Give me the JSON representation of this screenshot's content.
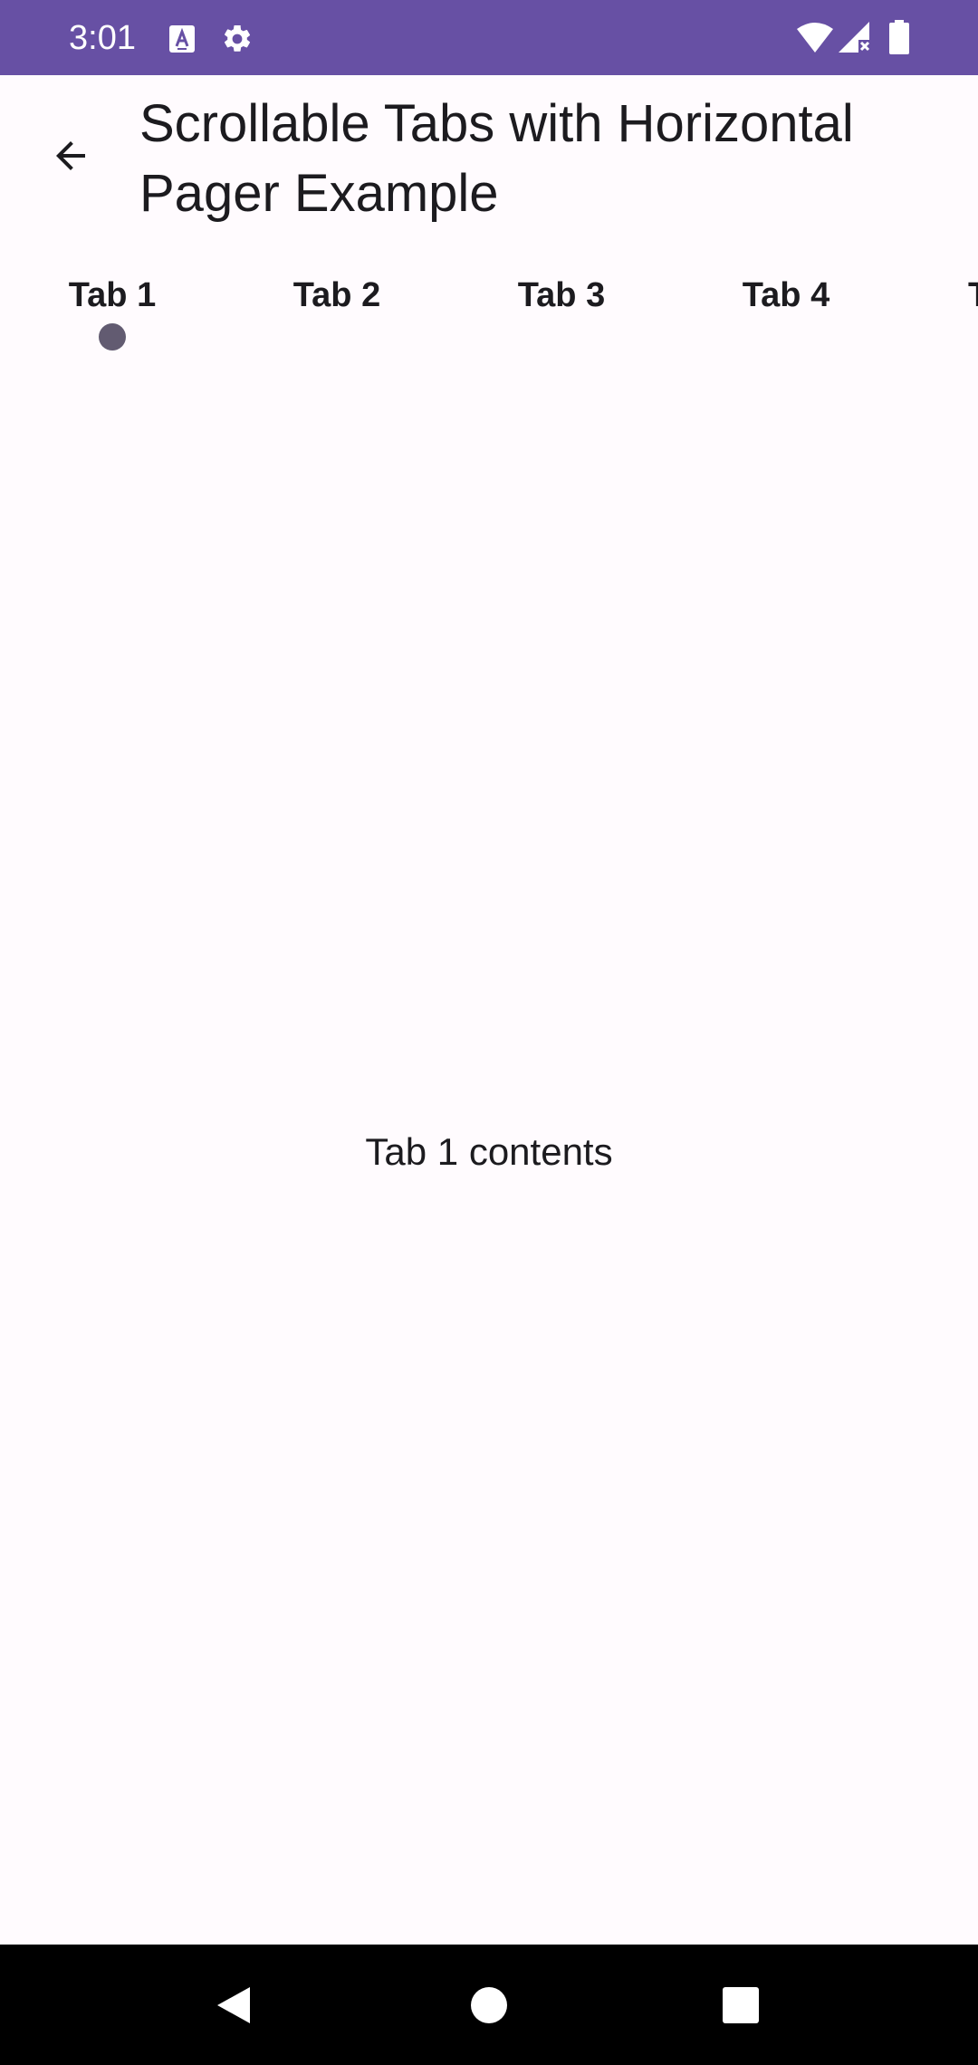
{
  "status_bar": {
    "time": "3:01",
    "left_icons": [
      "a11y-text-icon",
      "settings-gear-icon"
    ],
    "right_icons": [
      "wifi-icon",
      "cell-signal-no-data-icon",
      "battery-icon"
    ],
    "background": "#6750a4"
  },
  "app_bar": {
    "title": "Scrollable Tabs with Horizontal Pager Example",
    "back_icon": "arrow-back-icon"
  },
  "tabs": {
    "items": [
      {
        "label": "Tab 1",
        "selected": true
      },
      {
        "label": "Tab 2",
        "selected": false
      },
      {
        "label": "Tab 3",
        "selected": false
      },
      {
        "label": "Tab 4",
        "selected": false
      },
      {
        "label": "T",
        "selected": false
      }
    ],
    "indicator_color": "#625b71"
  },
  "pager": {
    "content": "Tab 1 contents"
  },
  "nav_bar": {
    "icons": [
      "back-triangle-icon",
      "home-circle-icon",
      "recents-square-icon"
    ]
  }
}
